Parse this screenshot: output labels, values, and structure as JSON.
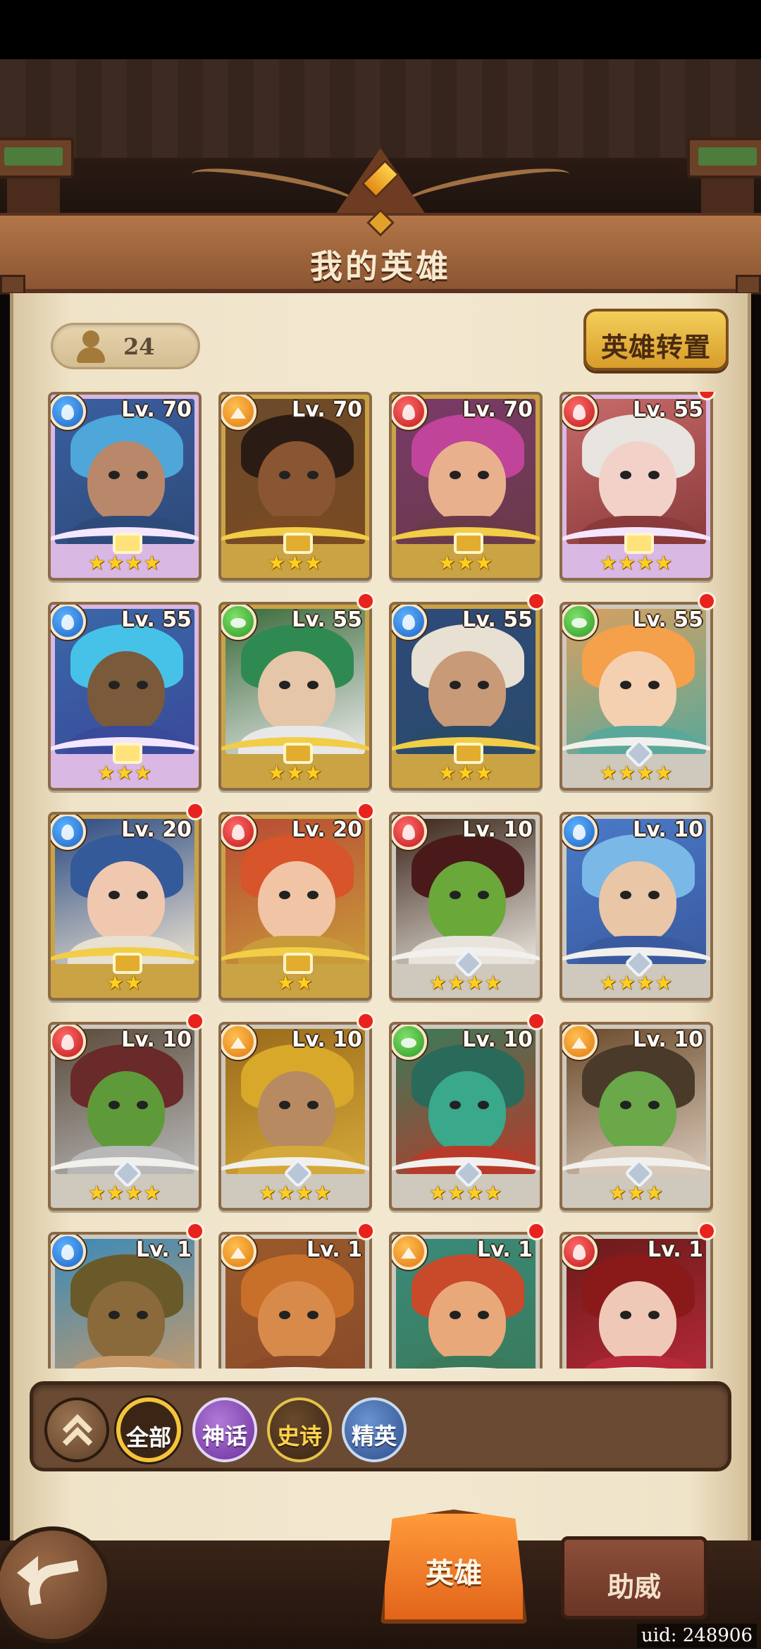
{
  "title": "我的英雄",
  "hero_count": "24",
  "transfer_label": "英雄转置",
  "heroes": [
    {
      "level": "Lv. 70",
      "element": "water-icon",
      "rarity": "myth",
      "stars": "★★★★",
      "notify": false
    },
    {
      "level": "Lv. 70",
      "element": "earth-icon",
      "rarity": "epic",
      "stars": "★★★",
      "notify": false
    },
    {
      "level": "Lv. 70",
      "element": "fire-icon",
      "rarity": "epic",
      "stars": "★★★",
      "notify": false
    },
    {
      "level": "Lv. 55",
      "element": "fire-icon",
      "rarity": "myth",
      "stars": "★★★★",
      "notify": true
    },
    {
      "level": "Lv. 55",
      "element": "water-icon",
      "rarity": "myth",
      "stars": "★★★",
      "notify": false
    },
    {
      "level": "Lv. 55",
      "element": "nature-icon",
      "rarity": "epic",
      "stars": "★★★",
      "notify": true
    },
    {
      "level": "Lv. 55",
      "element": "water-icon",
      "rarity": "epic",
      "stars": "★★★",
      "notify": true
    },
    {
      "level": "Lv. 55",
      "element": "nature-icon",
      "rarity": "elite",
      "stars": "★★★★",
      "notify": true
    },
    {
      "level": "Lv. 20",
      "element": "water-icon",
      "rarity": "epic",
      "stars": "★★",
      "notify": true
    },
    {
      "level": "Lv. 20",
      "element": "fire-icon",
      "rarity": "epic",
      "stars": "★★",
      "notify": true
    },
    {
      "level": "Lv. 10",
      "element": "fire-icon",
      "rarity": "elite",
      "stars": "★★★★",
      "notify": false
    },
    {
      "level": "Lv. 10",
      "element": "water-icon",
      "rarity": "elite",
      "stars": "★★★★",
      "notify": false
    },
    {
      "level": "Lv. 10",
      "element": "fire-icon",
      "rarity": "elite",
      "stars": "★★★★",
      "notify": true
    },
    {
      "level": "Lv. 10",
      "element": "earth-icon",
      "rarity": "elite",
      "stars": "★★★★",
      "notify": true
    },
    {
      "level": "Lv. 10",
      "element": "nature-icon",
      "rarity": "elite",
      "stars": "★★★★",
      "notify": true
    },
    {
      "level": "Lv. 10",
      "element": "earth-icon",
      "rarity": "elite",
      "stars": "★★★",
      "notify": false
    },
    {
      "level": "Lv. 1",
      "element": "water-icon",
      "rarity": "elite",
      "stars": "",
      "notify": true
    },
    {
      "level": "Lv. 1",
      "element": "earth-icon",
      "rarity": "elite",
      "stars": "",
      "notify": true
    },
    {
      "level": "Lv. 1",
      "element": "earth-icon",
      "rarity": "elite",
      "stars": "",
      "notify": true
    },
    {
      "level": "Lv. 1",
      "element": "fire-icon",
      "rarity": "elite",
      "stars": "",
      "notify": true
    }
  ],
  "filters": {
    "all": "全部",
    "myth": "神话",
    "epic": "史诗",
    "elite": "精英"
  },
  "tabs": {
    "heroes": "英雄",
    "cheer": "助威"
  },
  "uid": "uid: 248906",
  "colors": {
    "water": "#1e63c4",
    "fire": "#c01a1a",
    "earth": "#e0790f",
    "nature": "#2f9a26",
    "notify": "#e8221c",
    "active_tab": "#e2641a"
  }
}
